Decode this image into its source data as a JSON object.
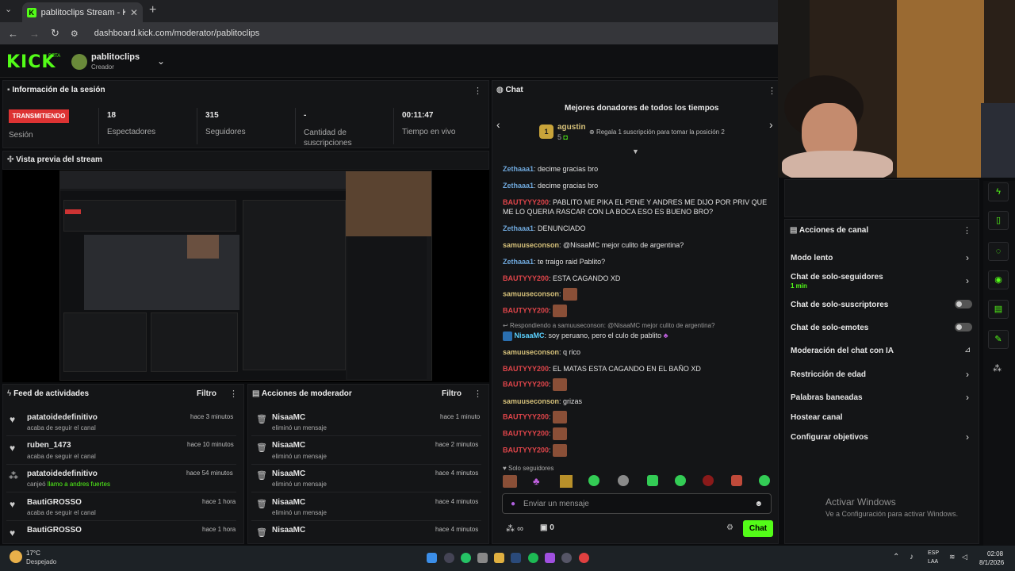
{
  "browser": {
    "tab_title": "pablitoclips Stream - Kick Dash",
    "url": "dashboard.kick.com/moderator/pablitoclips",
    "new_tab": "+"
  },
  "header": {
    "logo": "KICK",
    "beta": "BETA",
    "channel_name": "pablitoclips",
    "channel_role": "Creador"
  },
  "session": {
    "title": "Información de la sesión",
    "badge": "TRANSMITIENDO",
    "session_label": "Sesión",
    "stats": [
      {
        "value": "18",
        "label": "Espectadores"
      },
      {
        "value": "315",
        "label": "Seguidores"
      },
      {
        "value": "-",
        "label": "Cantidad de suscripciones"
      },
      {
        "value": "00:11:47",
        "label": "Tiempo en vivo"
      }
    ]
  },
  "preview": {
    "title": "Vista previa del stream"
  },
  "activity_feed": {
    "title": "Feed de actividades",
    "filter": "Filtro",
    "items": [
      {
        "name": "patatoidedefinitivo",
        "action": "acaba de seguir el canal",
        "time": "hace 3 minutos",
        "icon": "heart-icon"
      },
      {
        "name": "ruben_1473",
        "action": "acaba de seguir el canal",
        "time": "hace 10 minutos",
        "icon": "heart-icon"
      },
      {
        "name": "patatoidedefinitivo",
        "action": "canjeó",
        "highlight": "llamo a andres fuertes",
        "time": "hace 54 minutos",
        "icon": "points-icon"
      },
      {
        "name": "BautiGROSSO",
        "action": "acaba de seguir el canal",
        "time": "hace 1 hora",
        "icon": "heart-icon"
      },
      {
        "name": "BautiGROSSO",
        "action": "",
        "time": "hace 1 hora",
        "icon": "heart-icon"
      }
    ]
  },
  "mod_actions": {
    "title": "Acciones de moderador",
    "filter": "Filtro",
    "items": [
      {
        "name": "NisaaMC",
        "action": "eliminó un mensaje",
        "time": "hace 1 minuto"
      },
      {
        "name": "NisaaMC",
        "action": "eliminó un mensaje",
        "time": "hace 2 minutos"
      },
      {
        "name": "NisaaMC",
        "action": "eliminó un mensaje",
        "time": "hace 4 minutos"
      },
      {
        "name": "NisaaMC",
        "action": "eliminó un mensaje",
        "time": "hace 4 minutos"
      },
      {
        "name": "NisaaMC",
        "action": "",
        "time": "hace 4 minutos"
      }
    ]
  },
  "chat": {
    "title": "Chat",
    "donors_title": "Mejores donadores de todos los tiempos",
    "top_donor": {
      "rank": "1",
      "name": "agustin",
      "count": "5"
    },
    "gift_hint": "Regala 1 suscripción para tomar la posición 2",
    "messages": [
      {
        "user": "Zethaaa1",
        "color": "blue",
        "text": "decime gracias bro"
      },
      {
        "user": "Zethaaa1",
        "color": "blue",
        "text": "decime gracias bro"
      },
      {
        "user": "BAUTYYY200",
        "color": "red",
        "text": "PABLITO ME PIKA EL PENE Y ANDRES ME DIJO POR PRIV QUE ME LO QUERIA RASCAR CON LA BOCA ESO ES BUENO BRO?"
      },
      {
        "user": "Zethaaa1",
        "color": "blue",
        "text": "DENUNCIADO"
      },
      {
        "user": "samuuseconson",
        "color": "yellow",
        "text": "@NisaaMC mejor culito de argentina?"
      },
      {
        "user": "Zethaaa1",
        "color": "blue",
        "text": "te traigo raid Pablito?"
      },
      {
        "user": "BAUTYYY200",
        "color": "red",
        "text": "ESTA CAGANDO XD"
      },
      {
        "user": "samuuseconson",
        "color": "yellow",
        "text": "",
        "emote": true
      },
      {
        "user": "BAUTYYY200",
        "color": "red",
        "text": "",
        "emote": true
      },
      {
        "reply": "Respondiendo a samuuseconson: @NisaaMC mejor culito de argentina?"
      },
      {
        "user": "NisaaMC",
        "color": "cyan",
        "text": "soy peruano, pero el culo de pablito"
      },
      {
        "user": "samuuseconson",
        "color": "yellow",
        "text": "q rico"
      },
      {
        "user": "BAUTYYY200",
        "color": "red",
        "text": "EL MATAS ESTA CAGANDO EN EL BAÑO XD"
      },
      {
        "user": "BAUTYYY200",
        "color": "red",
        "text": "",
        "emote": true
      },
      {
        "user": "samuuseconson",
        "color": "yellow",
        "text": "grizas"
      },
      {
        "user": "BAUTYYY200",
        "color": "red",
        "text": "",
        "emote": true
      },
      {
        "user": "BAUTYYY200",
        "color": "red",
        "text": "",
        "emote": true
      },
      {
        "user": "BAUTYYY200",
        "color": "red",
        "text": "",
        "emote": true
      }
    ],
    "followers_only": "Solo seguidores",
    "input_placeholder": "Enviar un mensaje",
    "points_value": "∞",
    "gift_value": "0",
    "send_label": "Chat"
  },
  "channel_actions": {
    "title": "Acciones de canal",
    "items": [
      {
        "label": "Modo lento",
        "type": "chevron"
      },
      {
        "label": "Chat de solo-seguidores",
        "sub": "1 min",
        "type": "chevron"
      },
      {
        "label": "Chat de solo-suscriptores",
        "type": "toggle"
      },
      {
        "label": "Chat de solo-emotes",
        "type": "toggle"
      },
      {
        "label": "Moderación del chat con IA",
        "type": "chart"
      },
      {
        "label": "Restricción de edad",
        "type": "chevron"
      },
      {
        "label": "Palabras baneadas",
        "type": "chevron"
      },
      {
        "label": "Hostear canal",
        "type": "none"
      },
      {
        "label": "Configurar objetivos",
        "type": "chevron"
      }
    ]
  },
  "watermark": {
    "line1": "Activar Windows",
    "line2": "Ve a Configuración para activar Windows."
  },
  "taskbar": {
    "weather_temp": "17°C",
    "weather_desc": "Despejado",
    "lang1": "ESP",
    "lang2": "LAA",
    "time": "02:08",
    "date": "8/1/2026"
  },
  "colors": {
    "kick_green": "#53fc18",
    "live_red": "#dd3333"
  }
}
